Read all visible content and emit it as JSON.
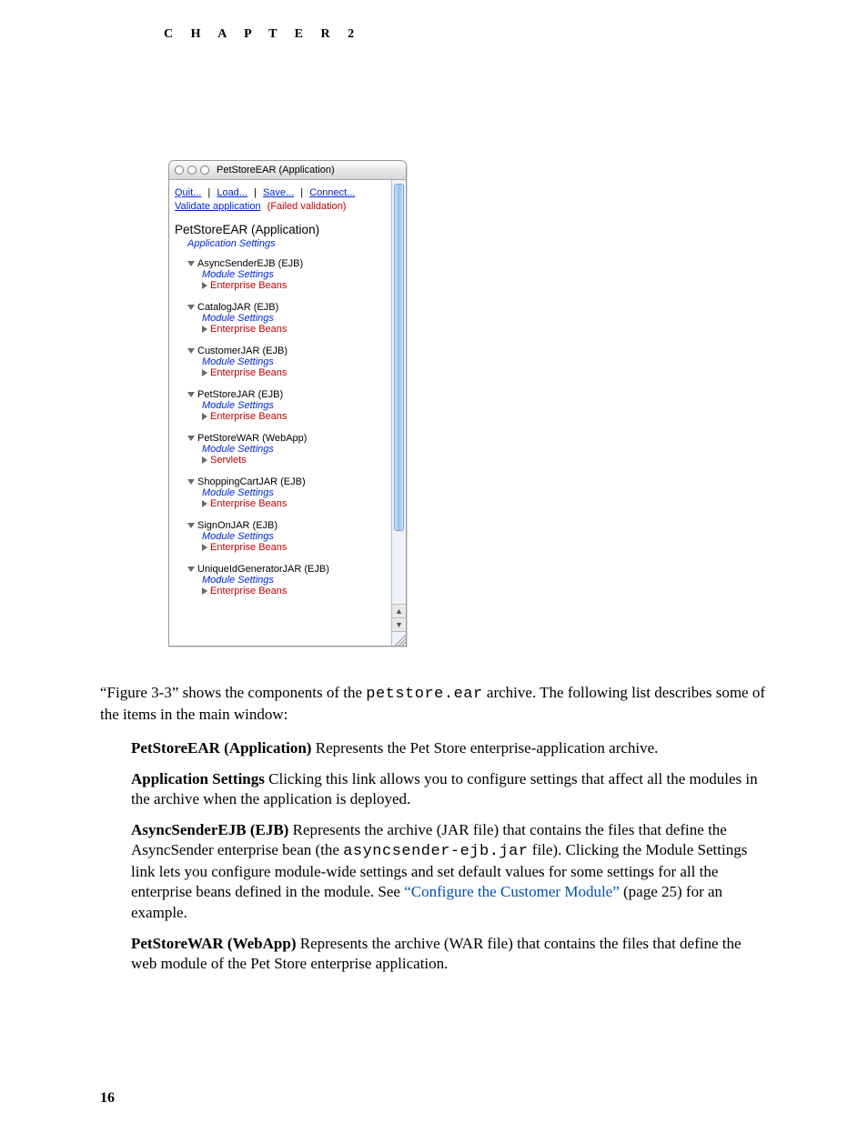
{
  "header": {
    "chapter_label": "C H A P T E R   2"
  },
  "window": {
    "title": "PetStoreEAR (Application)",
    "menu": {
      "quit": "Quit...",
      "load": "Load...",
      "save": "Save...",
      "connect": "Connect..."
    },
    "validate": {
      "link": "Validate application",
      "status": "(Failed validation)"
    },
    "tree": {
      "root": "PetStoreEAR (Application)",
      "app_settings": "Application Settings",
      "module_settings_label": "Module Settings",
      "modules": [
        {
          "name": "AsyncSenderEJB (EJB)",
          "sub": "Enterprise Beans"
        },
        {
          "name": "CatalogJAR (EJB)",
          "sub": "Enterprise Beans"
        },
        {
          "name": "CustomerJAR (EJB)",
          "sub": "Enterprise Beans"
        },
        {
          "name": "PetStoreJAR (EJB)",
          "sub": "Enterprise Beans"
        },
        {
          "name": "PetStoreWAR (WebApp)",
          "sub": "Servlets"
        },
        {
          "name": "ShoppingCartJAR (EJB)",
          "sub": "Enterprise Beans"
        },
        {
          "name": "SignOnJAR (EJB)",
          "sub": "Enterprise Beans"
        },
        {
          "name": "UniqueIdGeneratorJAR (EJB)",
          "sub": "Enterprise Beans"
        }
      ]
    }
  },
  "body": {
    "intro_a": "“Figure 3-3” shows the components of the ",
    "intro_code": "petstore.ear",
    "intro_b": " archive. The following list describes some of the items in the main window:",
    "items": [
      {
        "term": "PetStoreEAR (Application)",
        "text": " Represents the Pet Store enterprise-application archive."
      },
      {
        "term": "Application Settings",
        "text": " Clicking this link allows you to configure settings that affect all the modules in the archive when the application is deployed."
      },
      {
        "term": "AsyncSenderEJB (EJB)",
        "text_a": " Represents the archive (JAR file) that contains the files that define the AsyncSender enterprise bean (the ",
        "code": "asyncsender-ejb.jar",
        "text_b": " file). Clicking the Module Settings link lets you configure module-wide settings and set default values for some settings for all the enterprise beans defined in the module. See ",
        "link": "“Configure the Customer Module”",
        "text_c": " (page 25) for an example."
      },
      {
        "term": "PetStoreWAR (WebApp)",
        "text": " Represents the archive (WAR file) that contains the files that define the web module of the Pet Store enterprise application."
      }
    ]
  },
  "page_number": "16"
}
